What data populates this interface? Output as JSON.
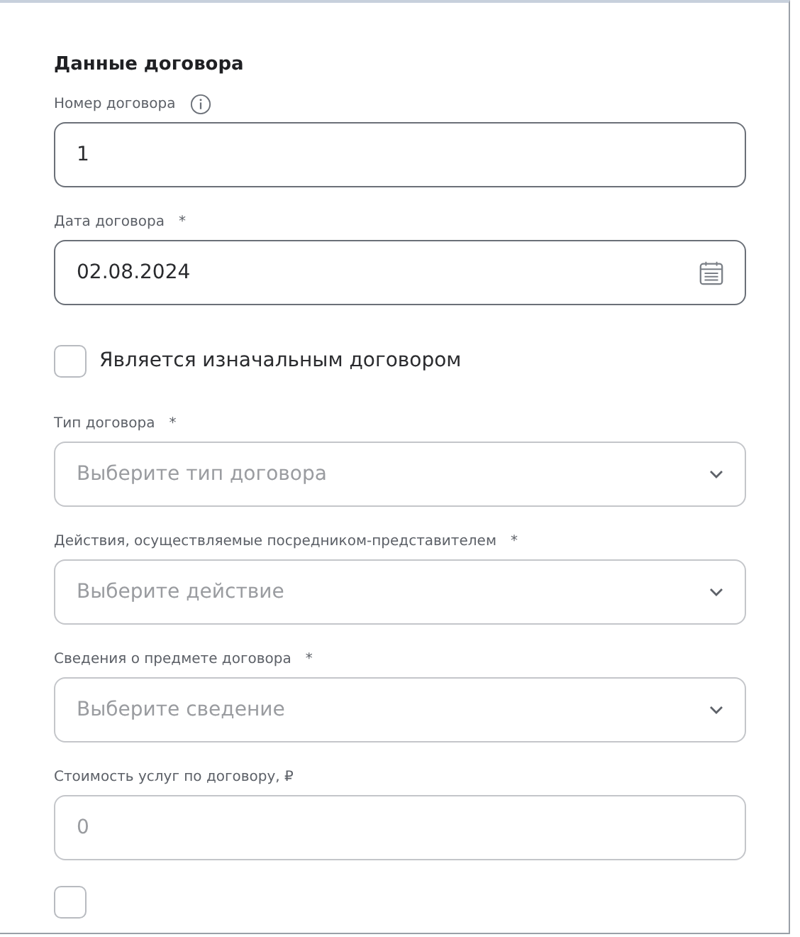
{
  "section_title": "Данные договора",
  "fields": [
    {
      "kind": "text",
      "label": "Номер договора",
      "info_icon": true,
      "value": "1"
    },
    {
      "kind": "date",
      "label": "Дата договора",
      "required_mark": "*",
      "value": "02.08.2024"
    },
    {
      "kind": "checkbox",
      "label": "Является изначальным договором",
      "checked": false
    },
    {
      "kind": "select",
      "label": "Тип договора",
      "required_mark": "*",
      "placeholder": "Выберите тип договора"
    },
    {
      "kind": "select",
      "label": "Действия, осуществляемые посредником-представителем",
      "required_mark": "*",
      "placeholder": "Выберите действие"
    },
    {
      "kind": "select",
      "label": "Сведения о предмете договора",
      "required_mark": "*",
      "placeholder": "Выберите сведение"
    },
    {
      "kind": "text",
      "label": "Стоимость услуг по договору, ₽",
      "placeholder": "0"
    },
    {
      "kind": "checkbox",
      "checked": false
    }
  ]
}
